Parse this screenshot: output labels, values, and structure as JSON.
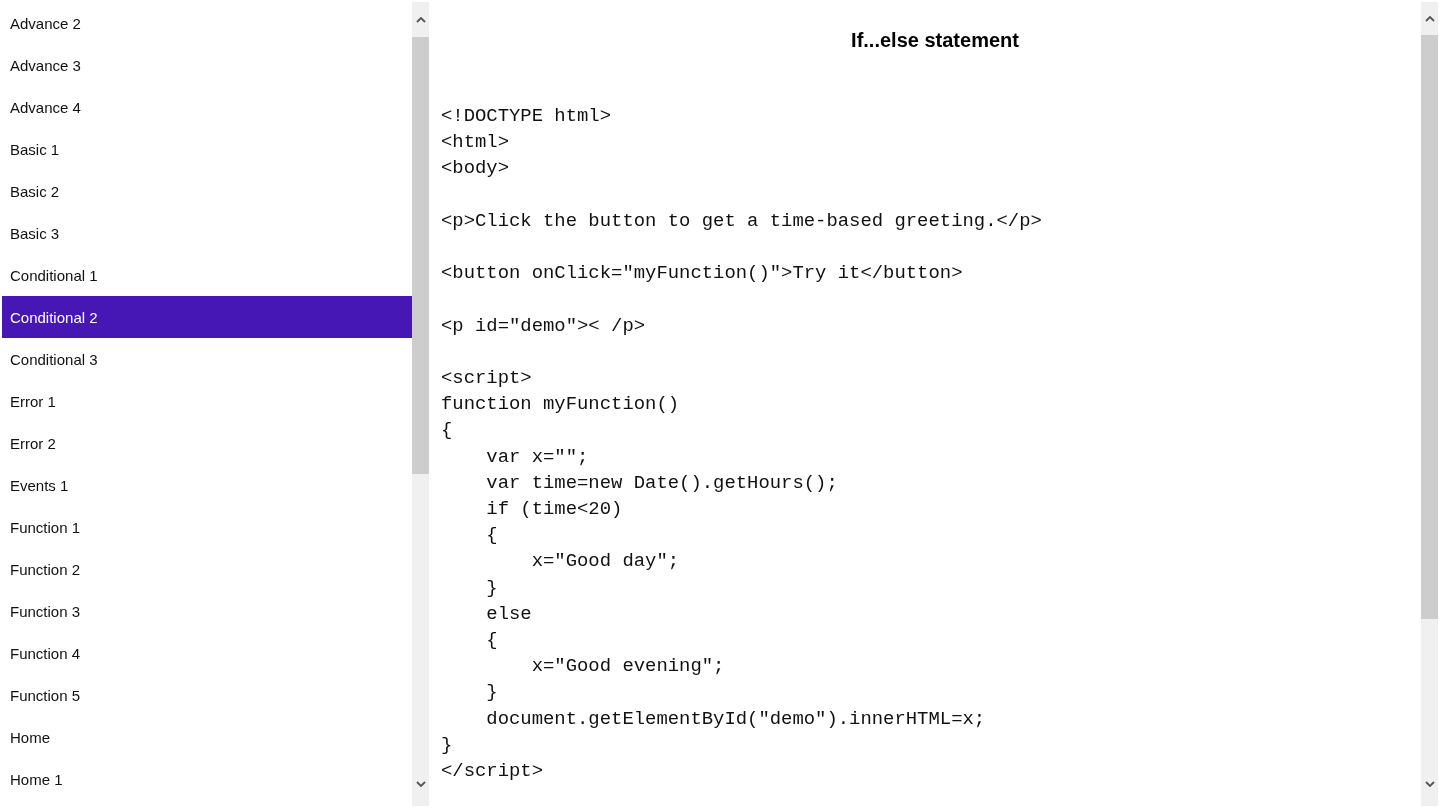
{
  "sidebar": {
    "items": [
      {
        "label": "Advance 2",
        "selected": false
      },
      {
        "label": "Advance 3",
        "selected": false
      },
      {
        "label": "Advance 4",
        "selected": false
      },
      {
        "label": "Basic 1",
        "selected": false
      },
      {
        "label": "Basic 2",
        "selected": false
      },
      {
        "label": "Basic 3",
        "selected": false
      },
      {
        "label": "Conditional 1",
        "selected": false
      },
      {
        "label": "Conditional 2",
        "selected": true
      },
      {
        "label": "Conditional 3",
        "selected": false
      },
      {
        "label": "Error 1",
        "selected": false
      },
      {
        "label": "Error 2",
        "selected": false
      },
      {
        "label": "Events 1",
        "selected": false
      },
      {
        "label": "Function 1",
        "selected": false
      },
      {
        "label": "Function 2",
        "selected": false
      },
      {
        "label": "Function 3",
        "selected": false
      },
      {
        "label": "Function 4",
        "selected": false
      },
      {
        "label": "Function 5",
        "selected": false
      },
      {
        "label": "Home",
        "selected": false
      },
      {
        "label": "Home 1",
        "selected": false
      }
    ]
  },
  "content": {
    "title": "If...else statement",
    "code": "<!DOCTYPE html>\n<html>\n<body>\n\n<p>Click the button to get a time-based greeting.</p>\n\n<button onClick=\"myFunction()\">Try it</button>\n\n<p id=\"demo\">< /p>\n\n<script>\nfunction myFunction()\n{\n    var x=\"\";\n    var time=new Date().getHours();\n    if (time<20)\n    {\n        x=\"Good day\";\n    }\n    else\n    {\n        x=\"Good evening\";\n    }\n    document.getElementById(\"demo\").innerHTML=x;\n}\n</script>"
  }
}
